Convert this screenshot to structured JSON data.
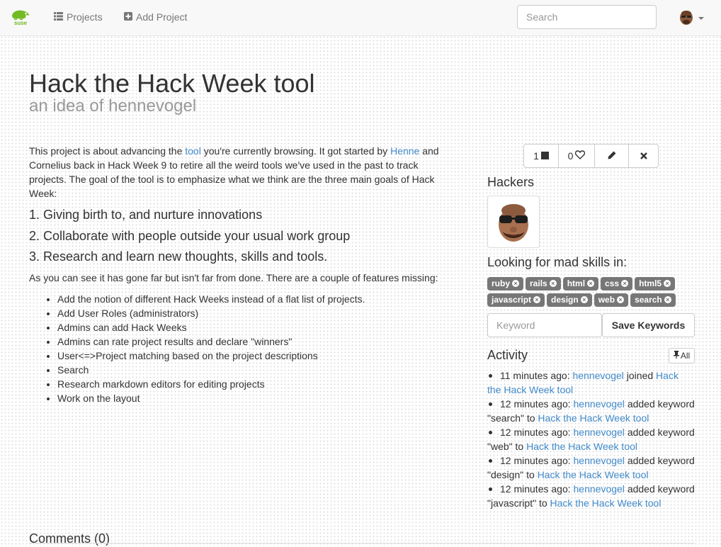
{
  "nav": {
    "logo_text": "suse",
    "projects_label": "Projects",
    "add_project_label": "Add Project",
    "search_placeholder": "Search"
  },
  "project": {
    "title": "Hack the Hack Week tool",
    "subtitle": "an idea of hennevogel",
    "intro": {
      "t1": "This project is about advancing the ",
      "link_tool": "tool",
      "t2": " you're currently browsing. It got started by ",
      "link_henne": "Henne",
      "t3": " and Cornelius back in Hack Week 9 to retire all the weird tools we've used in the past to track projects. The goal of the tool is to emphasize what we think are the three main goals of Hack Week:"
    },
    "goals": [
      "1. Giving birth to, and nurture innovations",
      "2. Collaborate with people outside your usual work group",
      "3. Research and learn new thoughts, skills and tools."
    ],
    "missing_intro": "As you can see it has gone far but isn't far from done. There are a couple of features missing:",
    "features": [
      "Add the notion of different Hack Weeks instead of a flat list of projects.",
      "Add User Roles (administrators)",
      "Admins can add Hack Weeks",
      "Admins can rate project results and declare \"winners\"",
      "User<=>Project matching based on the project descriptions",
      "Search",
      "Research markdown editors for editing projects",
      "Work on the layout"
    ],
    "comments_title": "Comments (0)"
  },
  "sidebar": {
    "join_count": "1",
    "like_count": "0",
    "hackers_title": "Hackers",
    "skills_title": "Looking for mad skills in:",
    "tags": [
      "ruby",
      "rails",
      "html",
      "css",
      "html5",
      "javascript",
      "design",
      "web",
      "search"
    ],
    "keyword_placeholder": "Keyword",
    "save_keywords_label": "Save Keywords",
    "activity_title": "Activity",
    "all_label": "All",
    "activity": [
      {
        "time": "11 minutes ago:",
        "user": "hennevogel",
        "action": "joined",
        "target": "Hack the Hack Week tool"
      },
      {
        "time": "12 minutes ago:",
        "user": "hennevogel",
        "action": "added keyword \"search\" to",
        "target": "Hack the Hack Week tool"
      },
      {
        "time": "12 minutes ago:",
        "user": "hennevogel",
        "action": "added keyword \"web\" to",
        "target": "Hack the Hack Week tool"
      },
      {
        "time": "12 minutes ago:",
        "user": "hennevogel",
        "action": "added keyword \"design\" to",
        "target": "Hack the Hack Week tool"
      },
      {
        "time": "12 minutes ago:",
        "user": "hennevogel",
        "action": "added keyword \"javascript\" to",
        "target": "Hack the Hack Week tool"
      }
    ]
  },
  "icons": {
    "logo": "suse-chameleon-icon",
    "projects": "list-icon",
    "add_project": "plus-square-icon",
    "join": "stop-square-icon",
    "like": "heart-outline-icon",
    "edit": "pencil-icon",
    "delete": "times-icon",
    "tag_remove": "times-circle-icon",
    "all": "pushpin-icon"
  },
  "colors": {
    "link": "#428bca",
    "brand_green": "#73ba25",
    "tag_bg": "#777777"
  }
}
